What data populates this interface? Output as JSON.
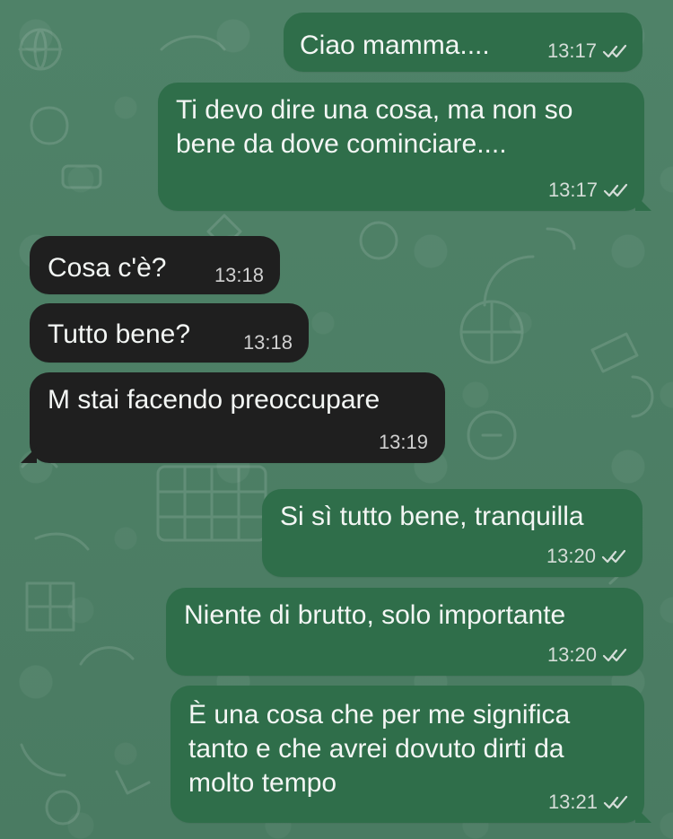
{
  "messages": [
    {
      "text": "Ciao mamma....",
      "time": "13:17",
      "status_icon": "double-check-icon"
    },
    {
      "text": "Ti devo dire una cosa, ma non so\nbene da dove cominciare....",
      "time": "13:17",
      "status_icon": "double-check-icon"
    },
    {
      "text": "Cosa c'è?",
      "time": "13:18"
    },
    {
      "text": "Tutto bene?",
      "time": "13:18"
    },
    {
      "text": "M stai facendo preoccupare",
      "time": "13:19"
    },
    {
      "text": "Si sì tutto bene, tranquilla",
      "time": "13:20",
      "status_icon": "double-check-icon"
    },
    {
      "text": "Niente di brutto, solo importante",
      "time": "13:20",
      "status_icon": "double-check-icon"
    },
    {
      "text": "È una cosa che per me significa\ntanto e che avrei dovuto dirti da\nmolto tempo",
      "time": "13:21",
      "status_icon": "double-check-icon"
    }
  ],
  "colors": {
    "background": "#4d7f66",
    "outgoing_bubble": "#2f6e4a",
    "incoming_bubble": "#1f1f1f"
  }
}
